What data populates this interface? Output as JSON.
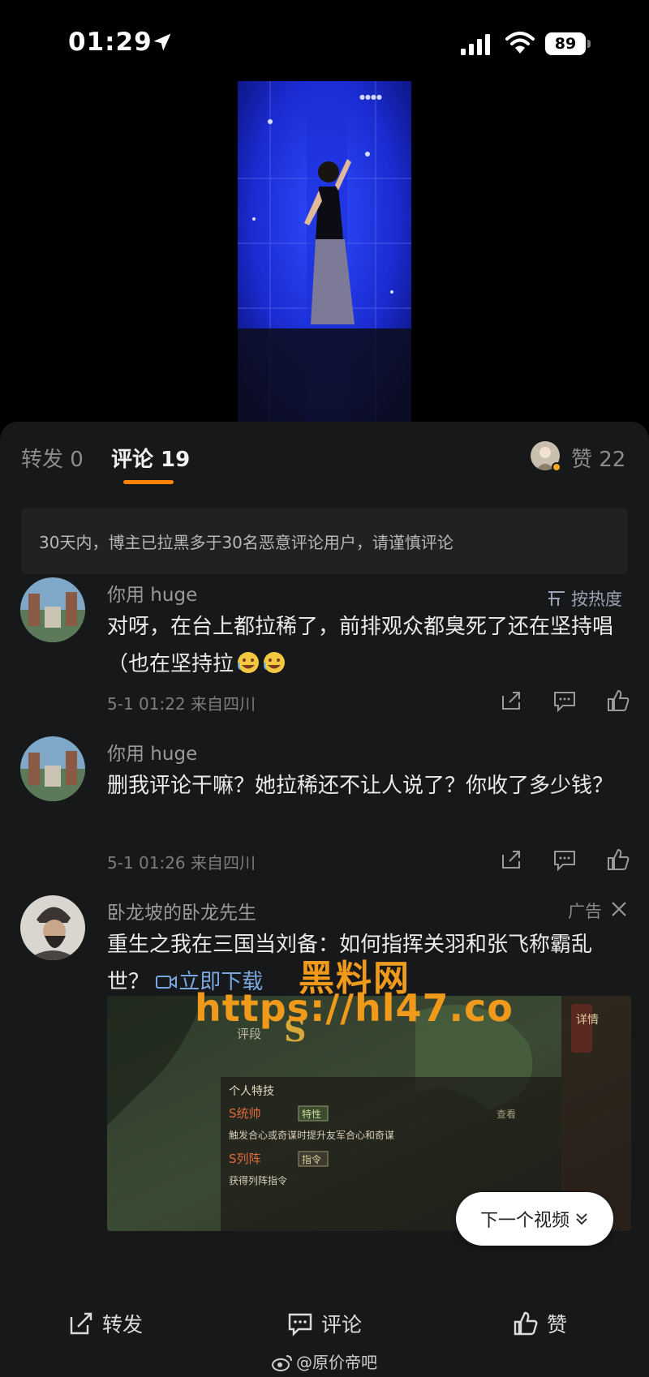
{
  "status_bar": {
    "time": "01:29",
    "battery": "89"
  },
  "tabs": {
    "repost": "转发 0",
    "comment": "评论 19",
    "like": "赞 22"
  },
  "notice": "30天内，博主已拉黑多于30名恶意评论用户，请谨慎评论",
  "sort_label": "按热度",
  "comments": [
    {
      "username": "你用 huge",
      "text": "对呀，在台上都拉稀了，前排观众都臭死了还在坚持唱（也在坚持拉",
      "meta": "5-1 01:22  来自四川"
    },
    {
      "username": "你用 huge",
      "text": "删我评论干嘛？她拉稀还不让人说了？你收了多少钱？",
      "meta": "5-1 01:26  来自四川"
    }
  ],
  "ad": {
    "username": "卧龙坡的卧龙先生",
    "tag": "广告",
    "text": "重生之我在三国当刘备：如何指挥关羽和张飞称霸乱世？",
    "download_label": "立即下载",
    "image_texts": {
      "rank_label": "评段",
      "rank_value": "S",
      "side_label": "详情",
      "panel_title": "个人特技",
      "skill1_name": "S统帅",
      "skill1_tag": "特性",
      "skill1_desc": "触发合心或奇谋时提升友军合心和奇谋",
      "skill2_name": "S列阵",
      "skill2_tag": "指令",
      "skill2_desc": "获得列阵指令",
      "view_label": "查看"
    }
  },
  "watermark": {
    "line1": "黑料网",
    "line2": "https://hl47.co"
  },
  "next_video": "下一个视频",
  "bottom_bar": {
    "repost": "转发",
    "comment": "评论",
    "like": "赞",
    "source": "@原价帝吧"
  },
  "colors": {
    "accent": "#ff8200",
    "panel_bg": "#161819",
    "watermark": "#f09a1c"
  }
}
